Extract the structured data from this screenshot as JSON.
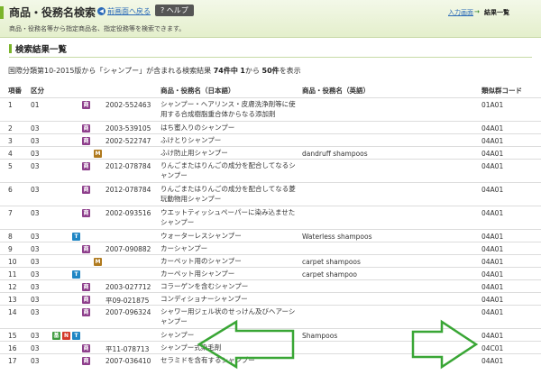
{
  "header": {
    "title": "商品・役務名検索",
    "back_label": "前画面へ戻る",
    "help_label": "ヘルプ",
    "subtitle": "商品・役務名等から指定商品名、指定役務等を検索できます。",
    "crumb_input": "入力画面",
    "crumb_current": "結果一覧"
  },
  "section": {
    "title": "検索結果一覧"
  },
  "summary": {
    "prefix": "国際分類第10-2015版から「シャンプー」が含まれる検索結果",
    "total": "74件中",
    "range_start": "1",
    "range_mid": "から",
    "range_end": "50件",
    "suffix": "を表示"
  },
  "table": {
    "columns": {
      "no": "項番",
      "kubun": "区分",
      "jp": "商品・役務名（日本語）",
      "en": "商品・役務名（英語）",
      "ruiji": "類似群コード"
    },
    "rows": [
      {
        "no": "1",
        "kubun": "01",
        "icons": [
          "S"
        ],
        "code": "2002-552463",
        "jp": "シャンプー・ヘアリンス・皮膚洗浄剤等に使用する合成樹脂重合体からなる添加剤",
        "en": "",
        "ruiji": "01A01"
      },
      {
        "no": "2",
        "kubun": "03",
        "icons": [
          "S"
        ],
        "code": "2003-539105",
        "jp": "はち蜜入りのシャンプー",
        "en": "",
        "ruiji": "04A01"
      },
      {
        "no": "3",
        "kubun": "03",
        "icons": [
          "S"
        ],
        "code": "2002-522747",
        "jp": "ふけとりシャンプー",
        "en": "",
        "ruiji": "04A01"
      },
      {
        "no": "4",
        "kubun": "03",
        "icons": [
          "M"
        ],
        "code": "",
        "jp": "ふけ防止用シャンプー",
        "en": "dandruff shampoos",
        "ruiji": "04A01"
      },
      {
        "no": "5",
        "kubun": "03",
        "icons": [
          "S"
        ],
        "code": "2012-078784",
        "jp": "りんごまたはりんごの成分を配合してなるシャンプー",
        "en": "",
        "ruiji": "04A01"
      },
      {
        "no": "6",
        "kubun": "03",
        "icons": [
          "S"
        ],
        "code": "2012-078784",
        "jp": "りんごまたはりんごの成分を配合してなる菱玩動物用シャンプー",
        "en": "",
        "ruiji": "04A01"
      },
      {
        "no": "7",
        "kubun": "03",
        "icons": [
          "S"
        ],
        "code": "2002-093516",
        "jp": "ウエットティッシュペーパーに染み込ませたシャンプー",
        "en": "",
        "ruiji": "04A01"
      },
      {
        "no": "8",
        "kubun": "03",
        "icons": [
          "T"
        ],
        "code": "",
        "jp": "ウォーターレスシャンプー",
        "en": "Waterless shampoos",
        "ruiji": "04A01"
      },
      {
        "no": "9",
        "kubun": "03",
        "icons": [
          "S"
        ],
        "code": "2007-090882",
        "jp": "カーシャンプー",
        "en": "",
        "ruiji": "04A01"
      },
      {
        "no": "10",
        "kubun": "03",
        "icons": [
          "M"
        ],
        "code": "",
        "jp": "カーペット用のシャンプー",
        "en": "carpet shampoos",
        "ruiji": "04A01"
      },
      {
        "no": "11",
        "kubun": "03",
        "icons": [
          "T"
        ],
        "code": "",
        "jp": "カーペット用シャンプー",
        "en": "carpet shampoo",
        "ruiji": "04A01"
      },
      {
        "no": "12",
        "kubun": "03",
        "icons": [
          "S"
        ],
        "code": "2003-027712",
        "jp": "コラーゲンを含むシャンプー",
        "en": "",
        "ruiji": "04A01"
      },
      {
        "no": "13",
        "kubun": "03",
        "icons": [
          "S"
        ],
        "code": "平09-021875",
        "jp": "コンディショナーシャンプー",
        "en": "",
        "ruiji": "04A01"
      },
      {
        "no": "14",
        "kubun": "03",
        "icons": [
          "S"
        ],
        "code": "2007-096324",
        "jp": "シャワー用ジェル状のせっけん及びヘアーシャンプー",
        "en": "",
        "ruiji": "04A01"
      },
      {
        "no": "15",
        "kubun": "03",
        "icons": [
          "G",
          "N",
          "T"
        ],
        "code": "",
        "jp": "シャンプー",
        "en": "Shampoos",
        "ruiji": "04A01"
      },
      {
        "no": "16",
        "kubun": "03",
        "icons": [
          "S"
        ],
        "code": "平11-078713",
        "jp": "シャンプー式染毛剤",
        "en": "",
        "ruiji": "04C01"
      },
      {
        "no": "17",
        "kubun": "03",
        "icons": [
          "S"
        ],
        "code": "2007-036410",
        "jp": "セラミドを含有するシャンプー",
        "en": "",
        "ruiji": "04A01"
      }
    ]
  },
  "icon_labels": {
    "S": "商",
    "M": "M",
    "T": "T",
    "N": "N",
    "G": "基"
  },
  "colors": {
    "accent": "#7ab42a",
    "link": "#2a6ab8",
    "arrow": "#39a635",
    "icon_s": "#8e3f8c",
    "icon_m": "#b07a1e",
    "icon_t": "#1f86c4",
    "icon_n": "#d33a2a",
    "icon_g": "#3e9b3e"
  }
}
